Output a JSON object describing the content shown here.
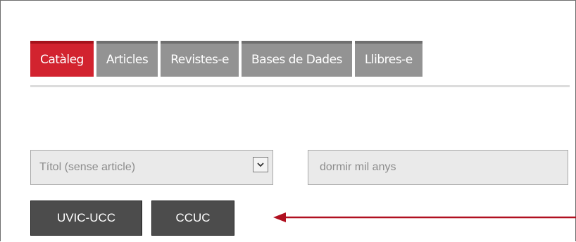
{
  "tabs": [
    {
      "label": "Catàleg",
      "active": true
    },
    {
      "label": "Articles",
      "active": false
    },
    {
      "label": "Revistes-e",
      "active": false
    },
    {
      "label": "Bases de Dades",
      "active": false
    },
    {
      "label": "Llibres-e",
      "active": false
    }
  ],
  "search": {
    "field_select_value": "Títol (sense article)",
    "query_value": "dormir mil anys"
  },
  "buttons": {
    "uvic_label": "UVIC-UCC",
    "ccuc_label": "CCUC"
  },
  "colors": {
    "active_tab": "#d2232f",
    "inactive_tab": "#939393",
    "button_bg": "#4c4c4c",
    "annotation_arrow": "#b01020"
  },
  "icons": {
    "select_arrow": "chevron-down-icon",
    "annotation": "arrow-left-icon"
  }
}
